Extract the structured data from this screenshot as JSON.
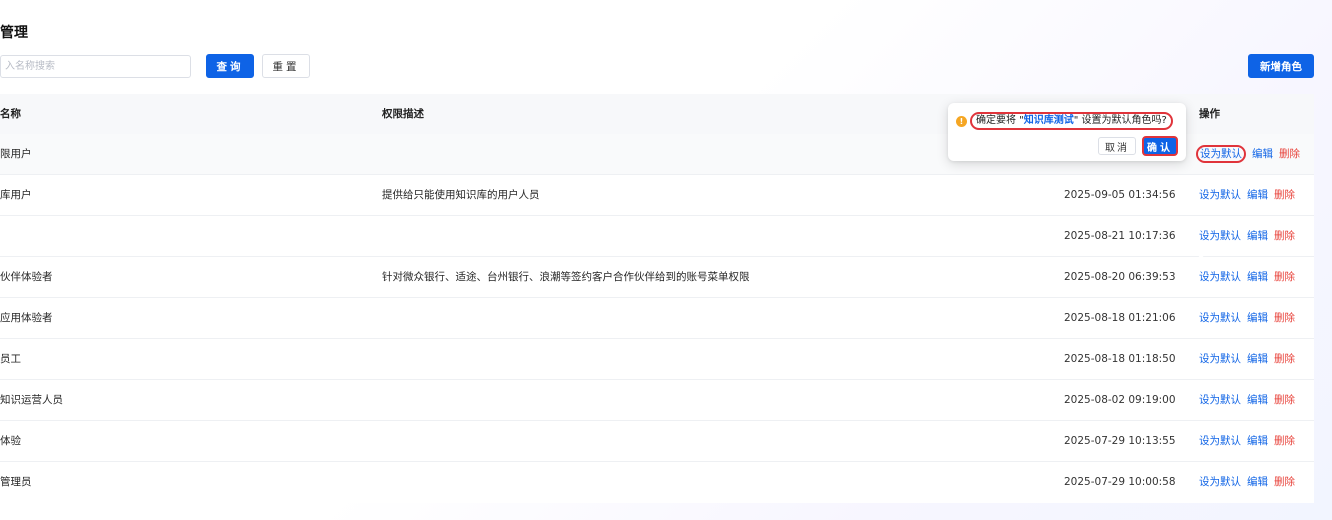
{
  "page": {
    "title": "管理"
  },
  "search": {
    "placeholder": "入名称搜索",
    "value": ""
  },
  "toolbar": {
    "query_label": "查询",
    "reset_label": "重置",
    "new_role_label": "新增角色"
  },
  "table": {
    "columns": {
      "name": "名称",
      "desc": "权限描述",
      "ops": "操作"
    },
    "rows": [
      {
        "name": "限用户",
        "desc": "",
        "time": ""
      },
      {
        "name": "库用户",
        "desc": "提供给只能使用知识库的用户人员",
        "time": "2025-09-05 01:34:56"
      },
      {
        "name": "",
        "desc": "",
        "time": "2025-08-21 10:17:36"
      },
      {
        "name": "伙伴体验者",
        "desc": "针对微众银行、适途、台州银行、浪潮等签约客户合作伙伴给到的账号菜单权限",
        "time": "2025-08-20 06:39:53"
      },
      {
        "name": "应用体验者",
        "desc": "",
        "time": "2025-08-18 01:21:06"
      },
      {
        "name": "员工",
        "desc": "",
        "time": "2025-08-18 01:18:50"
      },
      {
        "name": "知识运营人员",
        "desc": "",
        "time": "2025-08-02 09:19:00"
      },
      {
        "name": "体验",
        "desc": "",
        "time": "2025-07-29 10:13:55"
      },
      {
        "name": "管理员",
        "desc": "",
        "time": "2025-07-29 10:00:58"
      }
    ],
    "ops": {
      "set_default": "设为默认",
      "edit": "编辑",
      "delete": "删除"
    }
  },
  "popconfirm": {
    "message_prefix": "确定要将 \"",
    "role_name": "知识库测试",
    "message_suffix": "\" 设置为默认角色吗?",
    "cancel_label": "取消",
    "ok_label": "确认"
  },
  "colors": {
    "primary": "#0e63e6",
    "danger": "#e8423a",
    "warning": "#f5a623",
    "highlight": "#e0343b"
  },
  "icons": {
    "warning": "warning-icon"
  }
}
